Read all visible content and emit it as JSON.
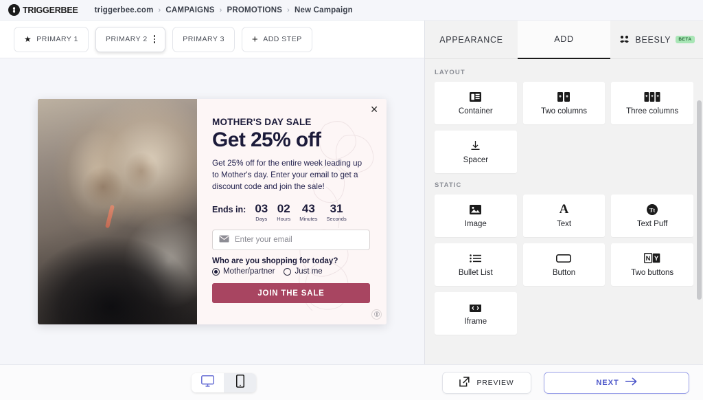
{
  "brand": {
    "name": "TRIGGERBEE",
    "logo_icon": "triggerbee-logo-icon"
  },
  "breadcrumb": {
    "items": [
      "triggerbee.com",
      "CAMPAIGNS",
      "PROMOTIONS",
      "New Campaign"
    ],
    "separator": "›"
  },
  "steps": [
    {
      "label": "PRIMARY 1",
      "icon": "star-icon",
      "active": false
    },
    {
      "label": "PRIMARY 2",
      "icon": "kebab-menu-icon",
      "active": true
    },
    {
      "label": "PRIMARY 3",
      "icon": "",
      "active": false
    },
    {
      "label": "ADD STEP",
      "icon": "plus-icon",
      "active": false
    }
  ],
  "popup": {
    "close_icon": "close-icon",
    "kicker": "MOTHER'S DAY SALE",
    "headline": "Get 25% off",
    "body": "Get 25% off for the entire week leading up to Mother's day. Enter your email to get a discount code and join the sale!",
    "countdown": {
      "label": "Ends in:",
      "units": [
        {
          "value": "03",
          "label": "Days"
        },
        {
          "value": "02",
          "label": "Hours"
        },
        {
          "value": "43",
          "label": "Minutes"
        },
        {
          "value": "31",
          "label": "Seconds"
        }
      ]
    },
    "email": {
      "placeholder": "Enter your email",
      "icon": "envelope-icon"
    },
    "question": "Who are you shopping for today?",
    "radios": [
      {
        "label": "Mother/partner",
        "selected": true
      },
      {
        "label": "Just me",
        "selected": false
      }
    ],
    "cta": "JOIN THE SALE",
    "accent_color": "#a84561",
    "headline_color": "#1c1b3a",
    "background_color": "#fdf6f6",
    "badge_icon": "triggerbee-badge-icon"
  },
  "panel": {
    "tabs": [
      {
        "label": "APPEARANCE",
        "active": false
      },
      {
        "label": "ADD",
        "active": true
      },
      {
        "label": "BEESLY",
        "active": false,
        "icon": "beesly-face-icon",
        "badge": "BETA",
        "badge_color": "#a9e6b6"
      }
    ],
    "sections": [
      {
        "label": "LAYOUT",
        "cards": [
          {
            "label": "Container",
            "icon": "container-icon"
          },
          {
            "label": "Two columns",
            "icon": "two-columns-icon"
          },
          {
            "label": "Three columns",
            "icon": "three-columns-icon"
          },
          {
            "label": "Spacer",
            "icon": "spacer-icon"
          }
        ]
      },
      {
        "label": "STATIC",
        "cards": [
          {
            "label": "Image",
            "icon": "image-icon"
          },
          {
            "label": "Text",
            "icon": "text-icon"
          },
          {
            "label": "Text Puff",
            "icon": "text-puff-icon"
          },
          {
            "label": "Bullet List",
            "icon": "bullet-list-icon"
          },
          {
            "label": "Button",
            "icon": "button-icon"
          },
          {
            "label": "Two buttons",
            "icon": "two-buttons-icon"
          },
          {
            "label": "Iframe",
            "icon": "iframe-icon"
          }
        ]
      }
    ]
  },
  "bottom": {
    "devices": [
      {
        "name": "desktop",
        "icon": "desktop-icon",
        "active": true
      },
      {
        "name": "mobile",
        "icon": "mobile-icon",
        "active": false
      }
    ],
    "preview_label": "PREVIEW",
    "preview_icon": "external-link-icon",
    "next_label": "NEXT",
    "next_icon": "arrow-right-icon",
    "next_color": "#4b55c9"
  }
}
